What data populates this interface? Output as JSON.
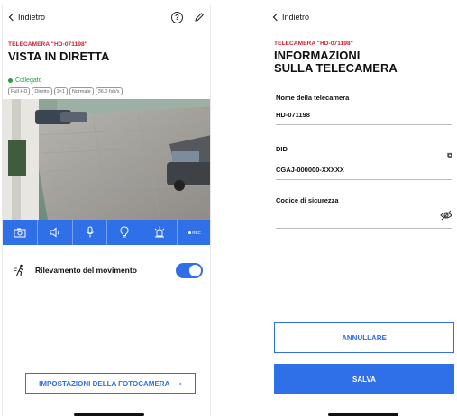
{
  "left": {
    "back_label": "Indietro",
    "subtitle": "TELECAMERA \"HD-071198\"",
    "title": "VISTA IN DIRETTA",
    "status": "Collegato",
    "chips": [
      "Full HD",
      "Diretto",
      "1×1",
      "Normale",
      "36.0 fsh/s"
    ],
    "controls": [
      "camera-icon",
      "speaker-icon",
      "microphone-icon",
      "light-icon",
      "siren-icon",
      "record-icon"
    ],
    "record_label": "REC",
    "motion_label": "Rilevamento del movimento",
    "motion_enabled": true,
    "settings_button": "IMPOSTAZIONI DELLA FOTOCAMERA",
    "settings_arrow": "⟶"
  },
  "right": {
    "back_label": "Indietro",
    "subtitle": "TELECAMERA \"HD-071198\"",
    "title_line1": "INFORMAZIONI",
    "title_line2": "SULLA TELECAMERA",
    "name_label": "Nome della telecamera",
    "name_value": "HD-071198",
    "did_label": "DID",
    "did_value": "CGAJ-000000-XXXXX",
    "copy_icon_glyph": "⧉",
    "security_label": "Codice di sicurezza",
    "security_value": "",
    "cancel_button": "ANNULLARE",
    "save_button": "SALVA"
  },
  "colors": {
    "accent": "#2f6fe8",
    "brand_red": "#d0202f",
    "status_green": "#2a9d3f"
  }
}
